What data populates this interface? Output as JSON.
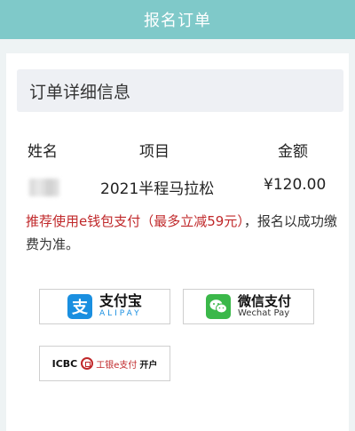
{
  "header": {
    "title": "报名订单"
  },
  "section": {
    "title": "订单详细信息"
  },
  "table": {
    "headers": {
      "name": "姓名",
      "item": "项目",
      "amount": "金额"
    },
    "row": {
      "item": "2021半程马拉松",
      "amount": "¥120.00"
    }
  },
  "notice": {
    "highlight": "推荐使用e钱包支付（最多立减59元）",
    "rest": "，报名以成功缴费为准。"
  },
  "payment": {
    "alipay": {
      "cn": "支付宝",
      "en": "ALIPAY",
      "glyph": "支",
      "icon": "alipay-icon",
      "color": "#1a8fe0"
    },
    "wechat": {
      "cn": "微信支付",
      "en": "Wechat Pay",
      "icon": "wechat-pay-icon",
      "color": "#3bb84a"
    },
    "icbc": {
      "en": "ICBC",
      "cn": "工银e支付",
      "open": "开户",
      "icon": "icbc-icon",
      "color": "#c0282a"
    }
  }
}
